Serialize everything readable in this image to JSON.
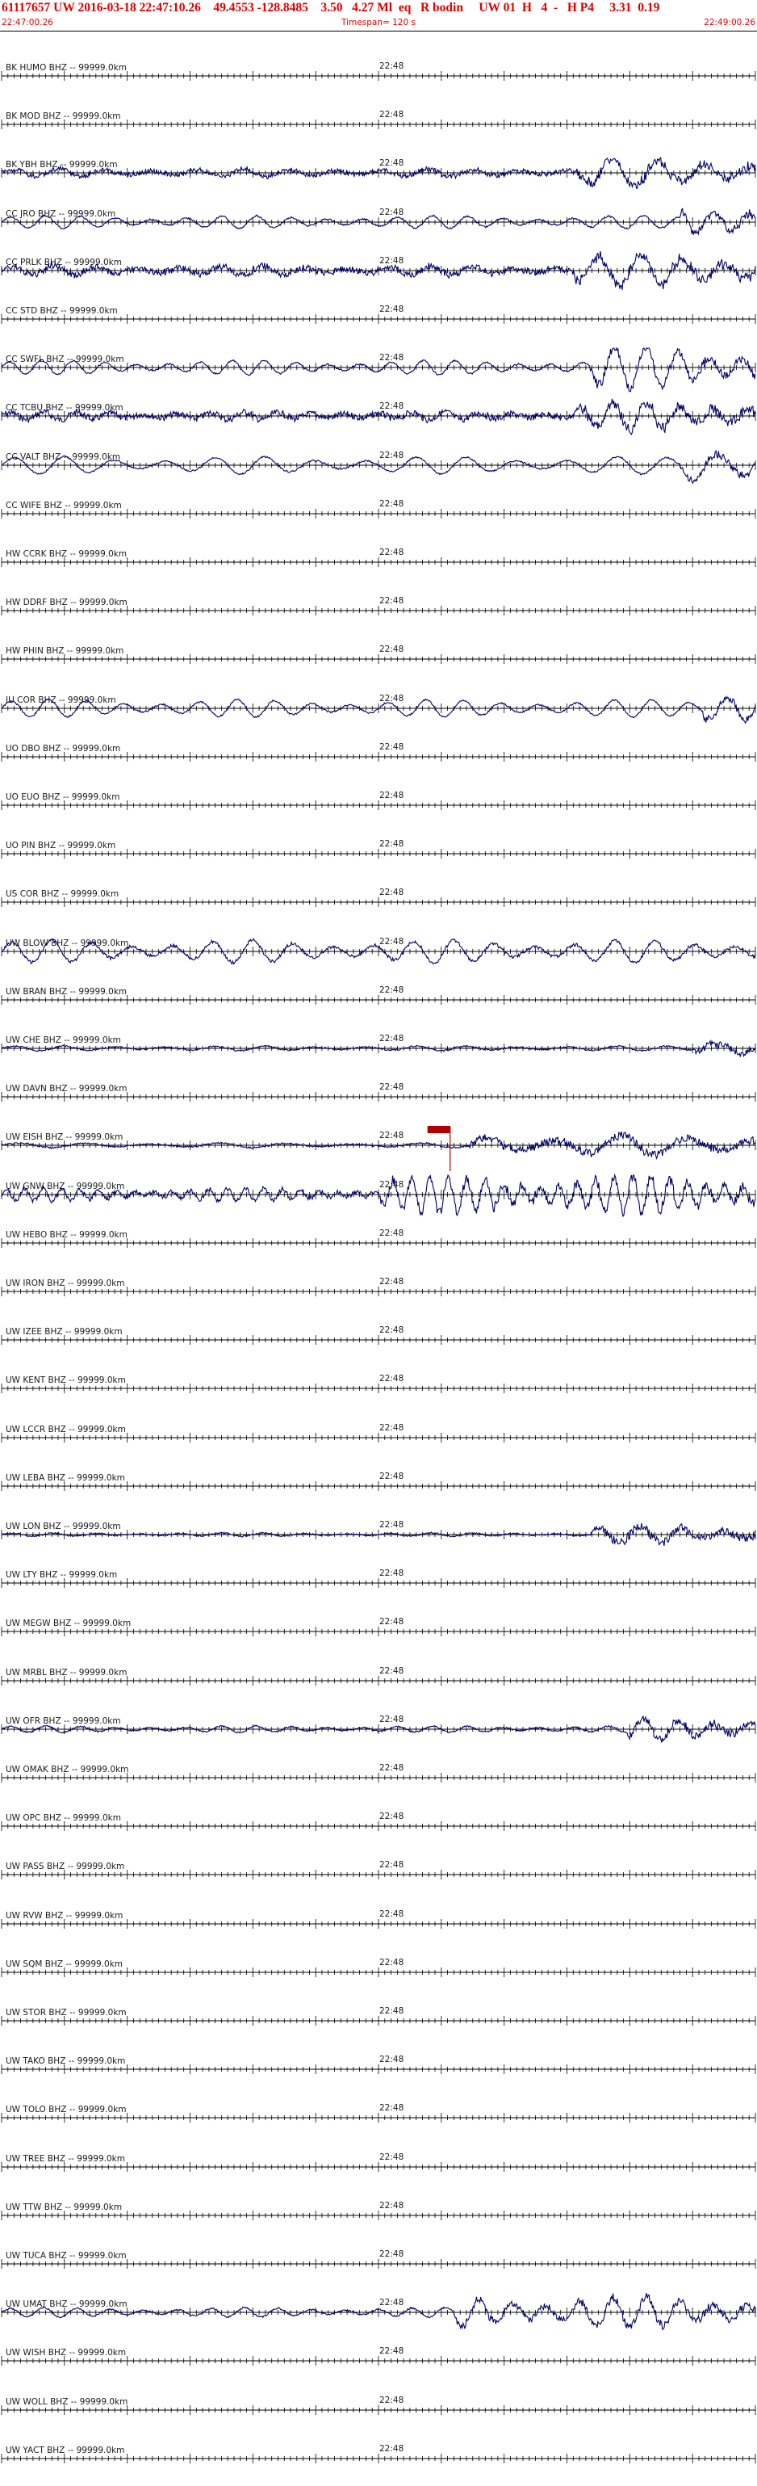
{
  "header": {
    "title": "61117657 UW 2016-03-18 22:47:10.26    49.4553 -128.8485    3.50   4.27 Ml  eq   R bodin     UW 01  H   4  -   H P4     3.31  0.19",
    "start_time": "22:47:00.26",
    "timespan": "Timespan= 120 s",
    "end_time": "22:49:00.26"
  },
  "colors": {
    "header_text": "#e00000",
    "trace": "#000066",
    "pick": "#b00000",
    "axis": "#000000"
  },
  "mid_tick_label": "22:48",
  "stations": [
    {
      "label": "BK HUMO BHZ -- 99999.0km",
      "amp": 0,
      "noise": 0,
      "onset": 1,
      "period": 40
    },
    {
      "label": "BK MOD BHZ -- 99999.0km",
      "amp": 0,
      "noise": 0,
      "onset": 1,
      "period": 40
    },
    {
      "label": "BK YBH BHZ -- 99999.0km",
      "amp": 5,
      "noise": 3,
      "onset": 0.76,
      "period": 55
    },
    {
      "label": "CC JRO BHZ -- 99999.0km",
      "amp": 8,
      "noise": 1,
      "onset": 0.9,
      "period": 42
    },
    {
      "label": "CC PRLK BHZ -- 99999.0km",
      "amp": 6,
      "noise": 4,
      "onset": 0.76,
      "period": 50
    },
    {
      "label": "CC STD BHZ -- 99999.0km",
      "amp": 0,
      "noise": 0,
      "onset": 1,
      "period": 40
    },
    {
      "label": "CC SWFL BHZ -- 99999.0km",
      "amp": 9,
      "noise": 1,
      "onset": 0.78,
      "period": 38
    },
    {
      "label": "CC TCBU BHZ -- 99999.0km",
      "amp": 5,
      "noise": 4,
      "onset": 0.76,
      "period": 40
    },
    {
      "label": "CC VALT BHZ -- 99999.0km",
      "amp": 11,
      "noise": 1,
      "onset": 0.9,
      "period": 60
    },
    {
      "label": "CC WIFE BHZ -- 99999.0km",
      "amp": 0,
      "noise": 0,
      "onset": 1,
      "period": 40
    },
    {
      "label": "HW CCRK BHZ -- 99999.0km",
      "amp": 0,
      "noise": 0,
      "onset": 1,
      "period": 40
    },
    {
      "label": "HW DDRF BHZ -- 99999.0km",
      "amp": 0,
      "noise": 0,
      "onset": 1,
      "period": 40
    },
    {
      "label": "HW PHIN BHZ -- 99999.0km",
      "amp": 0,
      "noise": 0,
      "onset": 1,
      "period": 40
    },
    {
      "label": "IU COR BHZ -- 99999.0km",
      "amp": 11,
      "noise": 1,
      "onset": 0.93,
      "period": 45
    },
    {
      "label": "UO DBO BHZ -- 99999.0km",
      "amp": 0,
      "noise": 0,
      "onset": 1,
      "period": 40
    },
    {
      "label": "UO EUO BHZ -- 99999.0km",
      "amp": 0,
      "noise": 0,
      "onset": 1,
      "period": 40
    },
    {
      "label": "UO PIN BHZ -- 99999.0km",
      "amp": 0,
      "noise": 0,
      "onset": 1,
      "period": 40
    },
    {
      "label": "US COR BHZ -- 99999.0km",
      "amp": 0,
      "noise": 0,
      "onset": 1,
      "period": 40
    },
    {
      "label": "UW BLOW BHZ -- 99999.0km",
      "amp": 14,
      "noise": 2,
      "onset": 1,
      "period": 48
    },
    {
      "label": "UW BRAN BHZ -- 99999.0km",
      "amp": 0,
      "noise": 0,
      "onset": 1,
      "period": 40
    },
    {
      "label": "UW CHE BHZ -- 99999.0km",
      "amp": 3,
      "noise": 1,
      "onset": 0.92,
      "period": 60
    },
    {
      "label": "UW DAVN BHZ -- 99999.0km",
      "amp": 0,
      "noise": 0,
      "onset": 1,
      "period": 40
    },
    {
      "label": "UW EISH BHZ -- 99999.0km",
      "amp": 3,
      "noise": 1,
      "onset": 0.62,
      "period": 80
    },
    {
      "label": "UW GNW BHZ -- 99999.0km",
      "amp": 8,
      "noise": 3,
      "onset": 0.5,
      "period": 22
    },
    {
      "label": "UW HEBO BHZ -- 99999.0km",
      "amp": 0,
      "noise": 0,
      "onset": 1,
      "period": 40
    },
    {
      "label": "UW IRON BHZ -- 99999.0km",
      "amp": 0,
      "noise": 0,
      "onset": 1,
      "period": 40
    },
    {
      "label": "UW IZEE BHZ -- 99999.0km",
      "amp": 0,
      "noise": 0,
      "onset": 1,
      "period": 40
    },
    {
      "label": "UW KENT BHZ -- 99999.0km",
      "amp": 0,
      "noise": 0,
      "onset": 1,
      "period": 40
    },
    {
      "label": "UW LCCR BHZ -- 99999.0km",
      "amp": 0,
      "noise": 0,
      "onset": 1,
      "period": 40
    },
    {
      "label": "UW LEBA BHZ -- 99999.0km",
      "amp": 0,
      "noise": 0,
      "onset": 1,
      "period": 40
    },
    {
      "label": "UW LON BHZ -- 99999.0km",
      "amp": 2,
      "noise": 1,
      "onset": 0.78,
      "period": 50
    },
    {
      "label": "UW LTY BHZ -- 99999.0km",
      "amp": 0,
      "noise": 0,
      "onset": 1,
      "period": 40
    },
    {
      "label": "UW MEGW BHZ -- 99999.0km",
      "amp": 0,
      "noise": 0,
      "onset": 1,
      "period": 40
    },
    {
      "label": "UW MRBL BHZ -- 99999.0km",
      "amp": 0,
      "noise": 0,
      "onset": 1,
      "period": 40
    },
    {
      "label": "UW OFR BHZ -- 99999.0km",
      "amp": 4,
      "noise": 1,
      "onset": 0.83,
      "period": 42
    },
    {
      "label": "UW OMAK BHZ -- 99999.0km",
      "amp": 0,
      "noise": 0,
      "onset": 1,
      "period": 40
    },
    {
      "label": "UW OPC BHZ -- 99999.0km",
      "amp": 0,
      "noise": 0,
      "onset": 1,
      "period": 40
    },
    {
      "label": "UW PASS BHZ -- 99999.0km",
      "amp": 0,
      "noise": 0,
      "onset": 1,
      "period": 40
    },
    {
      "label": "UW RVW BHZ -- 99999.0km",
      "amp": 0,
      "noise": 0,
      "onset": 1,
      "period": 40
    },
    {
      "label": "UW SQM BHZ -- 99999.0km",
      "amp": 0,
      "noise": 0,
      "onset": 1,
      "period": 40
    },
    {
      "label": "UW STOR BHZ -- 99999.0km",
      "amp": 0,
      "noise": 0,
      "onset": 1,
      "period": 40
    },
    {
      "label": "UW TAKO BHZ -- 99999.0km",
      "amp": 0,
      "noise": 0,
      "onset": 1,
      "period": 40
    },
    {
      "label": "UW TOLO BHZ -- 99999.0km",
      "amp": 0,
      "noise": 0,
      "onset": 1,
      "period": 40
    },
    {
      "label": "UW TREE BHZ -- 99999.0km",
      "amp": 0,
      "noise": 0,
      "onset": 1,
      "period": 40
    },
    {
      "label": "UW TTW BHZ -- 99999.0km",
      "amp": 0,
      "noise": 0,
      "onset": 1,
      "period": 40
    },
    {
      "label": "UW TUCA BHZ -- 99999.0km",
      "amp": 0,
      "noise": 0,
      "onset": 1,
      "period": 40
    },
    {
      "label": "UW UMAT BHZ -- 99999.0km",
      "amp": 6,
      "noise": 1,
      "onset": 0.6,
      "period": 40
    },
    {
      "label": "UW WISH BHZ -- 99999.0km",
      "amp": 0,
      "noise": 0,
      "onset": 1,
      "period": 40
    },
    {
      "label": "UW WOLL BHZ -- 99999.0km",
      "amp": 0,
      "noise": 0,
      "onset": 1,
      "period": 40
    },
    {
      "label": "UW YACT BHZ -- 99999.0km",
      "amp": 0,
      "noise": 0,
      "onset": 1,
      "period": 40
    }
  ],
  "pick": {
    "station": "UW EISH BHZ -- 99999.0km",
    "time_fraction": 0.595
  }
}
